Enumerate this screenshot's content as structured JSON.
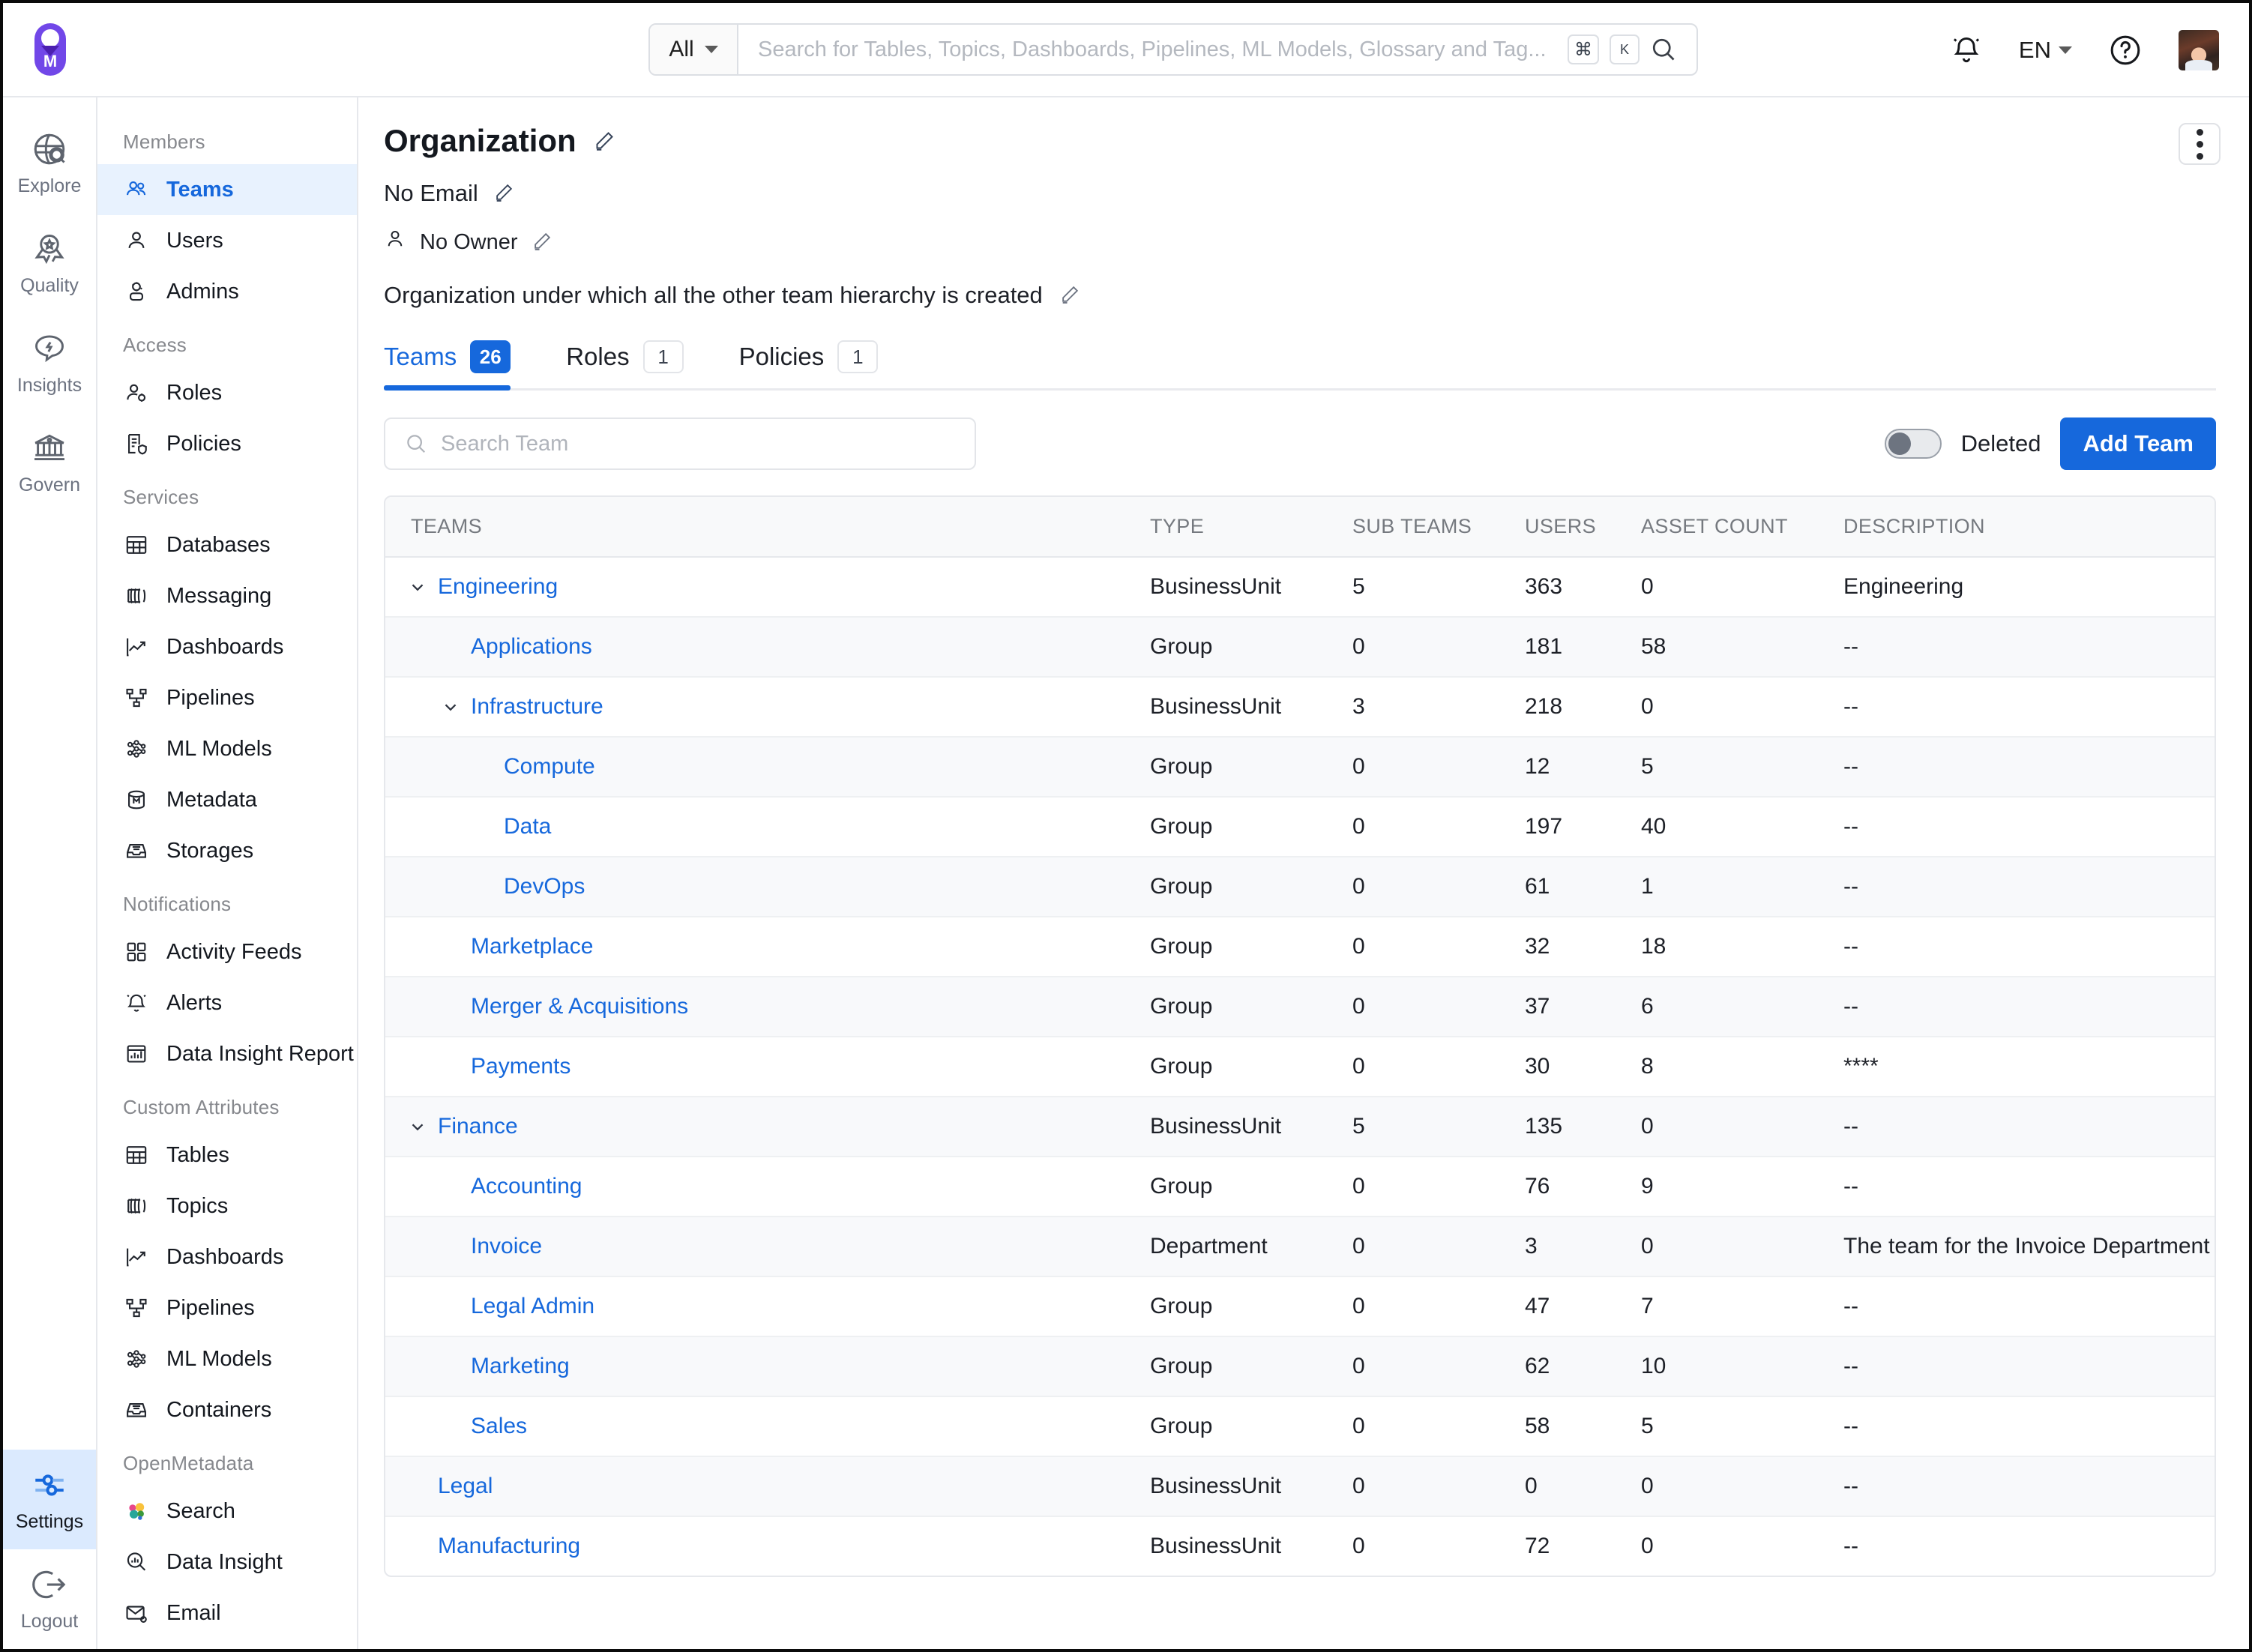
{
  "topbar": {
    "logo_icon": "openmetadata-logo-icon",
    "search_scope": "All",
    "search_placeholder": "Search for Tables, Topics, Dashboards, Pipelines, ML Models, Glossary and Tag...",
    "kbd_cmd": "⌘",
    "kbd_key": "K",
    "search_icon": "search-icon",
    "bell_icon": "bell-icon",
    "language": "EN",
    "help_icon": "question-circle-icon",
    "avatar": "user-avatar"
  },
  "rail": {
    "items": [
      {
        "label": "Explore",
        "icon": "globe-search-icon",
        "active": false
      },
      {
        "label": "Quality",
        "icon": "award-ribbon-icon",
        "active": false
      },
      {
        "label": "Insights",
        "icon": "speech-bolt-icon",
        "active": false
      },
      {
        "label": "Govern",
        "icon": "bank-icon",
        "active": false
      }
    ],
    "bottom": [
      {
        "label": "Settings",
        "icon": "sliders-icon",
        "active": true
      },
      {
        "label": "Logout",
        "icon": "logout-arrow-icon",
        "active": false
      }
    ]
  },
  "sidebar": {
    "groups": [
      {
        "title": "Members",
        "items": [
          {
            "label": "Teams",
            "icon": "people-icon",
            "active": true
          },
          {
            "label": "Users",
            "icon": "person-icon",
            "active": false
          },
          {
            "label": "Admins",
            "icon": "person-gear-icon",
            "active": false
          }
        ]
      },
      {
        "title": "Access",
        "items": [
          {
            "label": "Roles",
            "icon": "person-cog-icon",
            "active": false
          },
          {
            "label": "Policies",
            "icon": "document-shield-icon",
            "active": false
          }
        ]
      },
      {
        "title": "Services",
        "items": [
          {
            "label": "Databases",
            "icon": "table-grid-icon",
            "active": false
          },
          {
            "label": "Messaging",
            "icon": "topic-icon",
            "active": false
          },
          {
            "label": "Dashboards",
            "icon": "line-chart-icon",
            "active": false
          },
          {
            "label": "Pipelines",
            "icon": "pipeline-icon",
            "active": false
          },
          {
            "label": "ML Models",
            "icon": "ml-model-icon",
            "active": false
          },
          {
            "label": "Metadata",
            "icon": "database-m-icon",
            "active": false
          },
          {
            "label": "Storages",
            "icon": "storage-tray-icon",
            "active": false
          }
        ]
      },
      {
        "title": "Notifications",
        "items": [
          {
            "label": "Activity Feeds",
            "icon": "grid-squares-icon",
            "active": false
          },
          {
            "label": "Alerts",
            "icon": "bell-icon",
            "active": false
          },
          {
            "label": "Data Insight Report",
            "icon": "report-icon",
            "active": false
          }
        ]
      },
      {
        "title": "Custom Attributes",
        "items": [
          {
            "label": "Tables",
            "icon": "table-grid-icon",
            "active": false
          },
          {
            "label": "Topics",
            "icon": "topic-icon",
            "active": false
          },
          {
            "label": "Dashboards",
            "icon": "line-chart-icon",
            "active": false
          },
          {
            "label": "Pipelines",
            "icon": "pipeline-icon",
            "active": false
          },
          {
            "label": "ML Models",
            "icon": "ml-model-icon",
            "active": false
          },
          {
            "label": "Containers",
            "icon": "storage-tray-icon",
            "active": false
          }
        ]
      },
      {
        "title": "OpenMetadata",
        "items": [
          {
            "label": "Search",
            "icon": "elasticsearch-icon",
            "active": false
          },
          {
            "label": "Data Insight",
            "icon": "magnifier-chart-icon",
            "active": false
          },
          {
            "label": "Email",
            "icon": "email-gear-icon",
            "active": false
          }
        ]
      }
    ]
  },
  "main": {
    "title": "Organization",
    "email": "No Email",
    "owner": "No Owner",
    "description": "Organization under which all the other team hierarchy is created",
    "kebab_icon": "more-vertical-icon",
    "edit_icon": "pencil-icon",
    "tabs": [
      {
        "label": "Teams",
        "count": "26",
        "active": true
      },
      {
        "label": "Roles",
        "count": "1",
        "active": false
      },
      {
        "label": "Policies",
        "count": "1",
        "active": false
      }
    ],
    "search_placeholder": "Search Team",
    "deleted_label": "Deleted",
    "deleted_on": false,
    "add_team_label": "Add Team",
    "table": {
      "columns": [
        "TEAMS",
        "TYPE",
        "SUB TEAMS",
        "USERS",
        "ASSET COUNT",
        "DESCRIPTION"
      ],
      "rows": [
        {
          "team": "Engineering",
          "level": 0,
          "expandable": true,
          "expanded": true,
          "type": "BusinessUnit",
          "sub_teams": "5",
          "users": "363",
          "asset_count": "0",
          "description": "Engineering"
        },
        {
          "team": "Applications",
          "level": 1,
          "expandable": false,
          "expanded": false,
          "type": "Group",
          "sub_teams": "0",
          "users": "181",
          "asset_count": "58",
          "description": "--"
        },
        {
          "team": "Infrastructure",
          "level": 1,
          "expandable": true,
          "expanded": true,
          "type": "BusinessUnit",
          "sub_teams": "3",
          "users": "218",
          "asset_count": "0",
          "description": "--"
        },
        {
          "team": "Compute",
          "level": 2,
          "expandable": false,
          "expanded": false,
          "type": "Group",
          "sub_teams": "0",
          "users": "12",
          "asset_count": "5",
          "description": "--"
        },
        {
          "team": "Data",
          "level": 2,
          "expandable": false,
          "expanded": false,
          "type": "Group",
          "sub_teams": "0",
          "users": "197",
          "asset_count": "40",
          "description": "--"
        },
        {
          "team": "DevOps",
          "level": 2,
          "expandable": false,
          "expanded": false,
          "type": "Group",
          "sub_teams": "0",
          "users": "61",
          "asset_count": "1",
          "description": "--"
        },
        {
          "team": "Marketplace",
          "level": 1,
          "expandable": false,
          "expanded": false,
          "type": "Group",
          "sub_teams": "0",
          "users": "32",
          "asset_count": "18",
          "description": "--"
        },
        {
          "team": "Merger & Acquisitions",
          "level": 1,
          "expandable": false,
          "expanded": false,
          "type": "Group",
          "sub_teams": "0",
          "users": "37",
          "asset_count": "6",
          "description": "--"
        },
        {
          "team": "Payments",
          "level": 1,
          "expandable": false,
          "expanded": false,
          "type": "Group",
          "sub_teams": "0",
          "users": "30",
          "asset_count": "8",
          "description": "****"
        },
        {
          "team": "Finance",
          "level": 0,
          "expandable": true,
          "expanded": true,
          "type": "BusinessUnit",
          "sub_teams": "5",
          "users": "135",
          "asset_count": "0",
          "description": "--"
        },
        {
          "team": "Accounting",
          "level": 1,
          "expandable": false,
          "expanded": false,
          "type": "Group",
          "sub_teams": "0",
          "users": "76",
          "asset_count": "9",
          "description": "--"
        },
        {
          "team": "Invoice",
          "level": 1,
          "expandable": false,
          "expanded": false,
          "type": "Department",
          "sub_teams": "0",
          "users": "3",
          "asset_count": "0",
          "description": "The team for the Invoice Department"
        },
        {
          "team": "Legal Admin",
          "level": 1,
          "expandable": false,
          "expanded": false,
          "type": "Group",
          "sub_teams": "0",
          "users": "47",
          "asset_count": "7",
          "description": "--"
        },
        {
          "team": "Marketing",
          "level": 1,
          "expandable": false,
          "expanded": false,
          "type": "Group",
          "sub_teams": "0",
          "users": "62",
          "asset_count": "10",
          "description": "--"
        },
        {
          "team": "Sales",
          "level": 1,
          "expandable": false,
          "expanded": false,
          "type": "Group",
          "sub_teams": "0",
          "users": "58",
          "asset_count": "5",
          "description": "--"
        },
        {
          "team": "Legal",
          "level": 0,
          "expandable": false,
          "expanded": false,
          "type": "BusinessUnit",
          "sub_teams": "0",
          "users": "0",
          "asset_count": "0",
          "description": "--"
        },
        {
          "team": "Manufacturing",
          "level": 0,
          "expandable": false,
          "expanded": false,
          "type": "BusinessUnit",
          "sub_teams": "0",
          "users": "72",
          "asset_count": "0",
          "description": "--"
        }
      ]
    }
  },
  "colors": {
    "accent": "#1668dc",
    "link": "#1668dc",
    "active_bg": "#e8f2fe",
    "border": "#e6e8ec",
    "muted_text": "#75797f"
  }
}
